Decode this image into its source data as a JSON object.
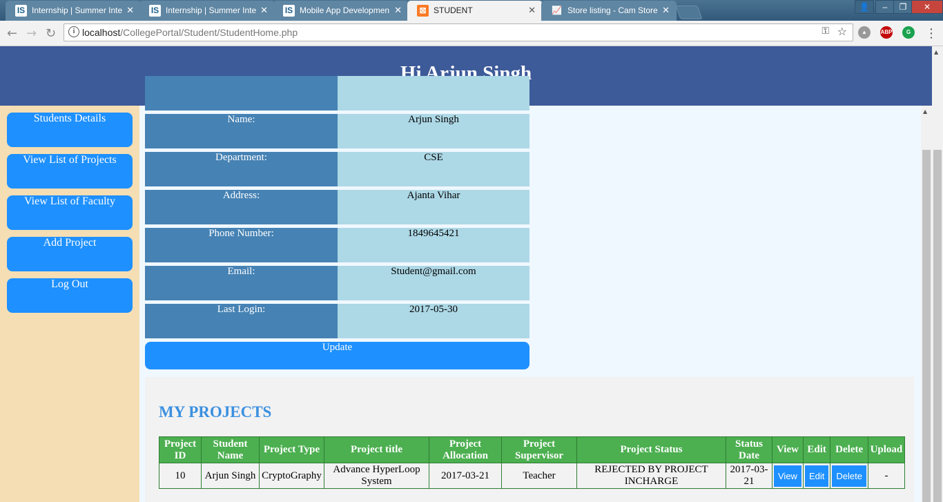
{
  "browser": {
    "tabs": [
      {
        "label": "Internship | Summer Inte",
        "favicon": "IS",
        "active": false
      },
      {
        "label": "Internship | Summer Inte",
        "favicon": "IS",
        "active": false
      },
      {
        "label": "Mobile App Developmen",
        "favicon": "IS",
        "active": false
      },
      {
        "label": "STUDENT",
        "favicon": "xampp-icon",
        "active": true
      },
      {
        "label": "Store listing - Cam Store",
        "favicon": "chart-icon",
        "active": false
      }
    ],
    "close_glyph": "✕",
    "url_host": "localhost",
    "url_path": "/CollegePortal/Student/StudentHome.php",
    "extension_abp": "ABP",
    "window_buttons": {
      "minimize": "–",
      "maximize": "❐",
      "close": "✕"
    }
  },
  "header": {
    "title": "Hi Arjun Singh",
    "bg_color": "#3d5a99"
  },
  "sidebar": {
    "items": [
      {
        "label": "Students Details"
      },
      {
        "label": "View List of Projects"
      },
      {
        "label": "View List of Faculty"
      },
      {
        "label": "Add Project"
      },
      {
        "label": "Log Out"
      }
    ],
    "button_color": "#1e90ff",
    "bg_color": "#f5deb3"
  },
  "details": {
    "rows": [
      {
        "label": "Name:",
        "value": "Arjun Singh"
      },
      {
        "label": "Department:",
        "value": "CSE"
      },
      {
        "label": "Address:",
        "value": "Ajanta Vihar"
      },
      {
        "label": "Phone Number:",
        "value": "1849645421"
      },
      {
        "label": "Email:",
        "value": "Student@gmail.com"
      },
      {
        "label": "Last Login:",
        "value": "2017-05-30"
      }
    ],
    "update_label": "Update"
  },
  "projects": {
    "title": "MY PROJECTS",
    "headers": [
      "Project ID",
      "Student Name",
      "Project Type",
      "Project title",
      "Project Allocation",
      "Project Supervisor",
      "Project Status",
      "Status Date",
      "View",
      "Edit",
      "Delete",
      "Upload"
    ],
    "rows": [
      {
        "id": "10",
        "student_name": "Arjun Singh",
        "type": "CryptoGraphy",
        "title": "Advance HyperLoop System",
        "allocation": "2017-03-21",
        "supervisor": "Teacher",
        "status": "REJECTED BY PROJECT INCHARGE",
        "status_date": "2017-03-21",
        "view_label": "View",
        "edit_label": "Edit",
        "delete_label": "Delete",
        "upload": "-"
      }
    ]
  }
}
